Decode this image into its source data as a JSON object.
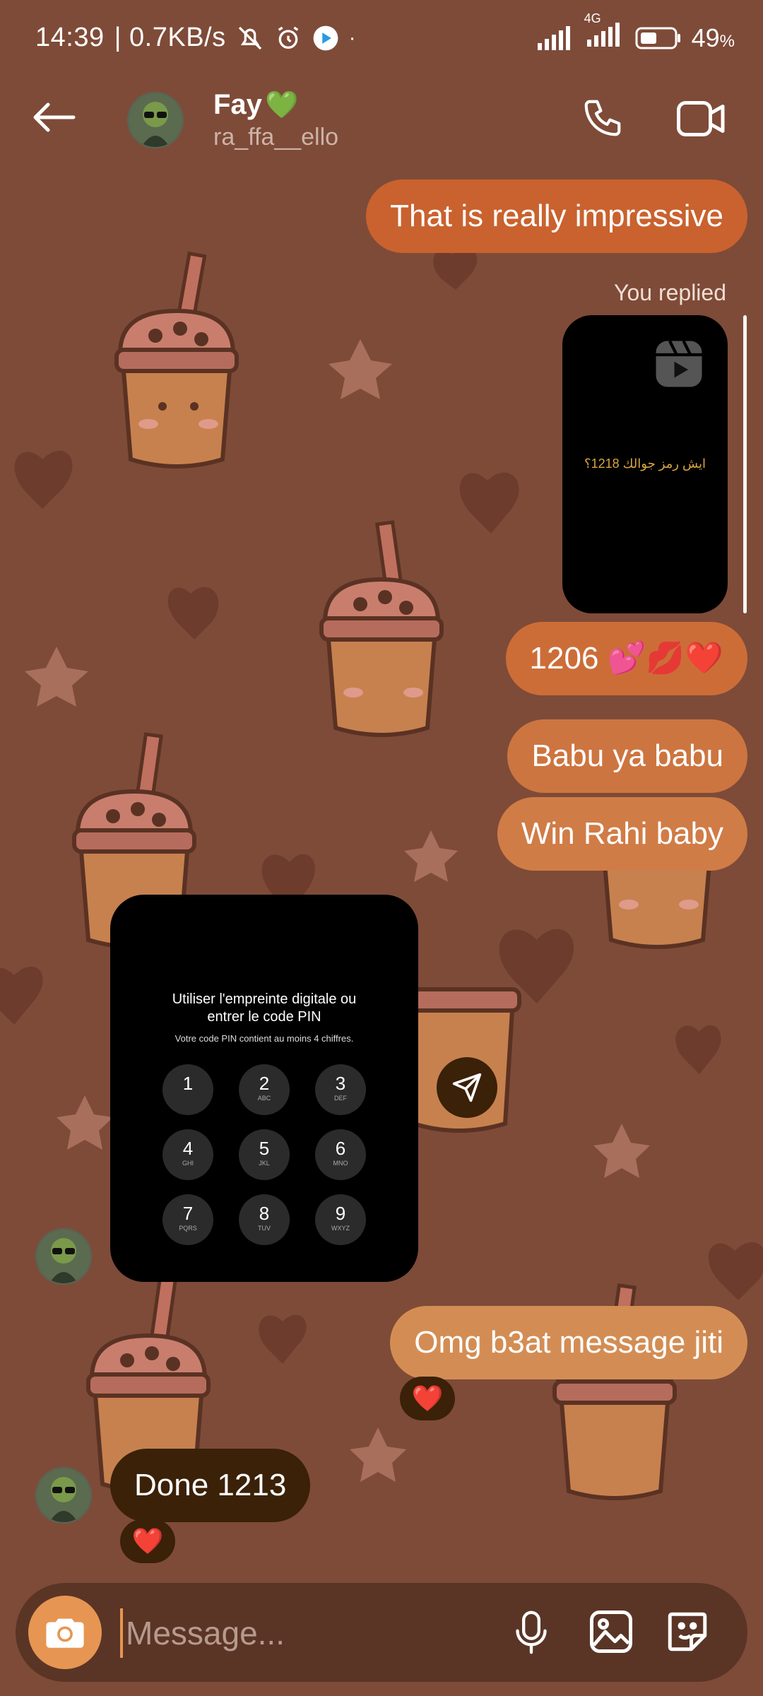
{
  "status_bar": {
    "time": "14:39",
    "speed": "| 0.7KB/s",
    "network": "4G",
    "battery": "49",
    "battery_unit": "%"
  },
  "header": {
    "name": "Fay",
    "name_emoji": "💚",
    "handle": "ra_ffa__ello"
  },
  "messages": {
    "m1": "That is really impressive",
    "replied_label": "You replied",
    "reel_caption": "ايش رمز جوالك 1218؟",
    "m2": "1206 💕💋❤️",
    "m3": "Babu ya babu",
    "m4": "Win Rahi baby",
    "pin": {
      "title_line1": "Utiliser l'empreinte digitale ou",
      "title_line2": "entrer le code PIN",
      "subtitle": "Votre code PIN contient au moins 4 chiffres.",
      "keys": [
        {
          "num": "1",
          "sub": ""
        },
        {
          "num": "2",
          "sub": "ABC"
        },
        {
          "num": "3",
          "sub": "DEF"
        },
        {
          "num": "4",
          "sub": "GHI"
        },
        {
          "num": "5",
          "sub": "JKL"
        },
        {
          "num": "6",
          "sub": "MNO"
        },
        {
          "num": "7",
          "sub": "PQRS"
        },
        {
          "num": "8",
          "sub": "TUV"
        },
        {
          "num": "9",
          "sub": "WXYZ"
        }
      ]
    },
    "m5": "Omg b3at message jiti",
    "m5_reaction": "❤️",
    "m6": "Done 1213",
    "m6_reaction": "❤️"
  },
  "input": {
    "placeholder": "Message..."
  },
  "colors": {
    "background": "#7e4b38",
    "sent_bubble": "#c9622e",
    "received_bubble": "#3a2108",
    "accent": "#e69652"
  }
}
